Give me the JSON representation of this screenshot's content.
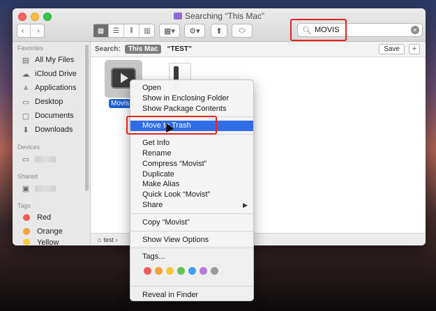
{
  "window": {
    "title": "Searching “This Mac”"
  },
  "search": {
    "value": "MOVIS"
  },
  "sidebar": {
    "favorites_header": "Favorites",
    "favorites": [
      {
        "label": "All My Files",
        "icon": "all-files-icon"
      },
      {
        "label": "iCloud Drive",
        "icon": "cloud-icon"
      },
      {
        "label": "Applications",
        "icon": "applications-icon"
      },
      {
        "label": "Desktop",
        "icon": "desktop-icon"
      },
      {
        "label": "Documents",
        "icon": "documents-icon"
      },
      {
        "label": "Downloads",
        "icon": "downloads-icon"
      }
    ],
    "devices_header": "Devices",
    "shared_header": "Shared",
    "tags_header": "Tags",
    "tags": [
      {
        "label": "Red",
        "color": "#fc5b57"
      },
      {
        "label": "Orange",
        "color": "#f6a134"
      },
      {
        "label": "Yellow",
        "color": "#f5cf3b"
      }
    ]
  },
  "search_scope": {
    "label": "Search:",
    "active": "This Mac",
    "inactive": "“TEST”",
    "save_label": "Save",
    "add_label": "+"
  },
  "files": [
    {
      "label": "Movis",
      "icon": "movist-app-icon"
    }
  ],
  "pathbar": {
    "text": "test ›"
  },
  "context_menu": {
    "group1": [
      "Open",
      "Show in Enclosing Folder",
      "Show Package Contents"
    ],
    "highlighted": "Move to Trash",
    "group2": [
      "Get Info",
      "Rename",
      "Compress “Movist”",
      "Duplicate",
      "Make Alias",
      "Quick Look “Movist”"
    ],
    "share": "Share",
    "copy": "Copy “Movist”",
    "view_options": "Show View Options",
    "tags_label": "Tags...",
    "tag_colors": [
      "#f05b5b",
      "#f4a13a",
      "#f2c93c",
      "#5fc54d",
      "#3f9df3",
      "#b67ad8",
      "#9a9a9a"
    ],
    "reveal": "Reveal in Finder"
  },
  "colors": {
    "accent": "#2f6ce5",
    "annotation": "#e82020"
  }
}
